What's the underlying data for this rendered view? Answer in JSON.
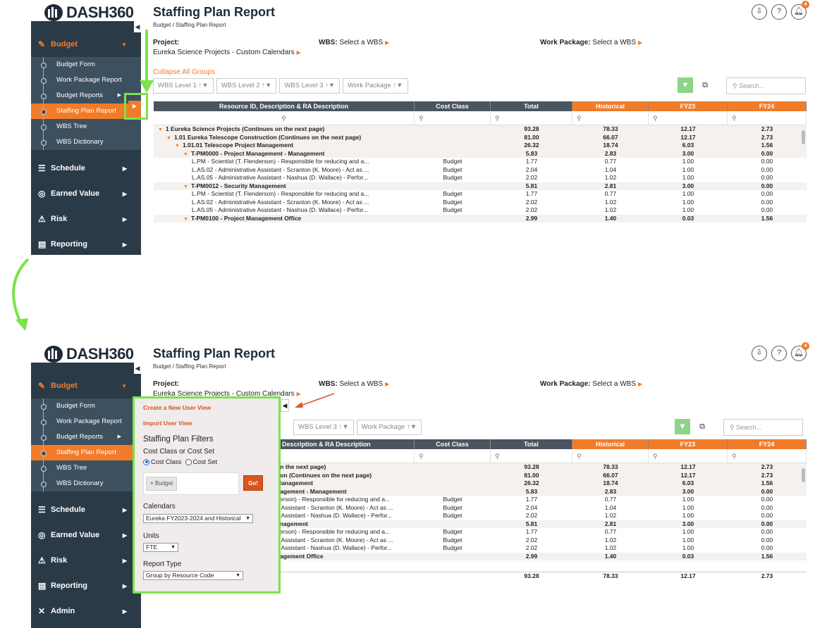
{
  "app": {
    "logo_text": "DASH360",
    "title": "Staffing Plan Report",
    "breadcrumb": "Budget / Staffing Plan Report",
    "notification_count": "4"
  },
  "sidebar": {
    "budget": "Budget",
    "items": [
      "Budget Form",
      "Work Package Report",
      "Budget Reports",
      "Staffing Plan Report",
      "WBS Tree",
      "WBS Dictionary"
    ],
    "sections": [
      "Schedule",
      "Earned Value",
      "Risk",
      "Reporting",
      "Admin"
    ]
  },
  "filters_bar": {
    "project_label": "Project:",
    "project_value": "Eureka Science Projects - Custom Calendars",
    "wbs_label": "WBS:",
    "wbs_value": "Select a WBS",
    "wp_label": "Work Package:",
    "wp_value": "Select a WBS",
    "collapse": "Collapse All Groups",
    "groups": [
      "WBS Level 1",
      "WBS Level 2",
      "WBS Level 3",
      "Work Package"
    ],
    "search_placeholder": "Search..."
  },
  "grid": {
    "columns": [
      "Resource ID, Description & RA Description",
      "Cost Class",
      "Total",
      "Historical",
      "FY23",
      "FY24"
    ],
    "column_b0": "Description & RA Description",
    "rows": [
      {
        "indent": 0,
        "bold": true,
        "desc": "1 Eureka Science Projects (Continues on the next page)",
        "descB": "on the next page)",
        "cc": "",
        "total": "93.28",
        "hist": "78.33",
        "fy23": "12.17",
        "fy24": "2.73"
      },
      {
        "indent": 1,
        "bold": true,
        "desc": "1.01 Eureka Telescope Construction (Continues on the next page)",
        "descB": "tion (Continues on the next page)",
        "cc": "",
        "total": "81.00",
        "hist": "66.07",
        "fy23": "12.17",
        "fy24": "2.73"
      },
      {
        "indent": 2,
        "bold": true,
        "desc": "1.01.01 Telescope Project Management",
        "descB": "Management",
        "cc": "",
        "total": "26.32",
        "hist": "18.74",
        "fy23": "6.03",
        "fy24": "1.56"
      },
      {
        "indent": 3,
        "bold": true,
        "desc": "T-PM0000 - Project Management - Management",
        "descB": "nagement - Management",
        "cc": "",
        "total": "5.83",
        "hist": "2.83",
        "fy23": "3.00",
        "fy24": "0.00"
      },
      {
        "indent": 4,
        "bold": false,
        "desc": "L.PM - Scientist (T. Flenderson) - Responsible for reducing and a...",
        "descB": "derson) - Responsible for reducing and a...",
        "cc": "Budget",
        "total": "1.77",
        "hist": "0.77",
        "fy23": "1.00",
        "fy24": "0.00"
      },
      {
        "indent": 4,
        "bold": false,
        "desc": "L.AS.02 - Administrative Assistant - Scranton (K. Moore) - Act as ...",
        "descB": "e Assistant - Scranton (K. Moore) - Act as ...",
        "cc": "Budget",
        "total": "2.04",
        "hist": "1.04",
        "fy23": "1.00",
        "fy24": "0.00"
      },
      {
        "indent": 4,
        "bold": false,
        "desc": "L.AS.05 - Administrative Assistant - Nashua (D. Wallace) - Perfor...",
        "descB": "e Assistant - Nashua (D. Wallace) - Perfor...",
        "cc": "Budget",
        "total": "2.02",
        "hist": "1.02",
        "fy23": "1.00",
        "fy24": "0.00"
      },
      {
        "indent": 3,
        "bold": true,
        "desc": "T-PM0012 - Security Management",
        "descB": "anagement",
        "cc": "",
        "total": "5.81",
        "hist": "2.81",
        "fy23": "3.00",
        "fy24": "0.00"
      },
      {
        "indent": 4,
        "bold": false,
        "desc": "L.PM - Scientist (T. Flenderson) - Responsible for reducing and a...",
        "descB": "derson) - Responsible for reducing and a...",
        "cc": "Budget",
        "total": "1.77",
        "hist": "0.77",
        "fy23": "1.00",
        "fy24": "0.00"
      },
      {
        "indent": 4,
        "bold": false,
        "desc": "L.AS.02 - Administrative Assistant - Scranton (K. Moore) - Act as ...",
        "descB": "e Assistant - Scranton (K. Moore) - Act as ...",
        "cc": "Budget",
        "total": "2.02",
        "hist": "1.02",
        "fy23": "1.00",
        "fy24": "0.00"
      },
      {
        "indent": 4,
        "bold": false,
        "desc": "L.AS.05 - Administrative Assistant - Nashua (D. Wallace) - Perfor...",
        "descB": "e Assistant - Nashua (D. Wallace) - Perfor...",
        "cc": "Budget",
        "total": "2.02",
        "hist": "1.02",
        "fy23": "1.00",
        "fy24": "0.00"
      },
      {
        "indent": 3,
        "bold": true,
        "desc": "T-PM0100 - Project Management Office",
        "descB": "nagement Office",
        "cc": "",
        "total": "2.99",
        "hist": "1.40",
        "fy23": "0.03",
        "fy24": "1.56"
      }
    ],
    "totals": {
      "total": "93.28",
      "hist": "78.33",
      "fy23": "12.17",
      "fy24": "2.73"
    }
  },
  "flyout": {
    "create_view": "Create a New User View",
    "import_view": "Import User View",
    "filters_title": "Staffing Plan Filters",
    "cost_label": "Cost Class or Cost Set",
    "radio_cost_class": "Cost Class",
    "radio_cost_set": "Cost Set",
    "tag": "Budget",
    "go": "Go!",
    "calendars_label": "Calendars",
    "calendars_value": "Eureka FY2023-2024 and Historical",
    "units_label": "Units",
    "units_value": "FTE",
    "report_type_label": "Report Type",
    "report_type_value": "Group by Resource Code"
  },
  "colors": {
    "accent": "#f07c2a",
    "highlight": "#7ae34a",
    "sidebar": "#2b3a47"
  }
}
